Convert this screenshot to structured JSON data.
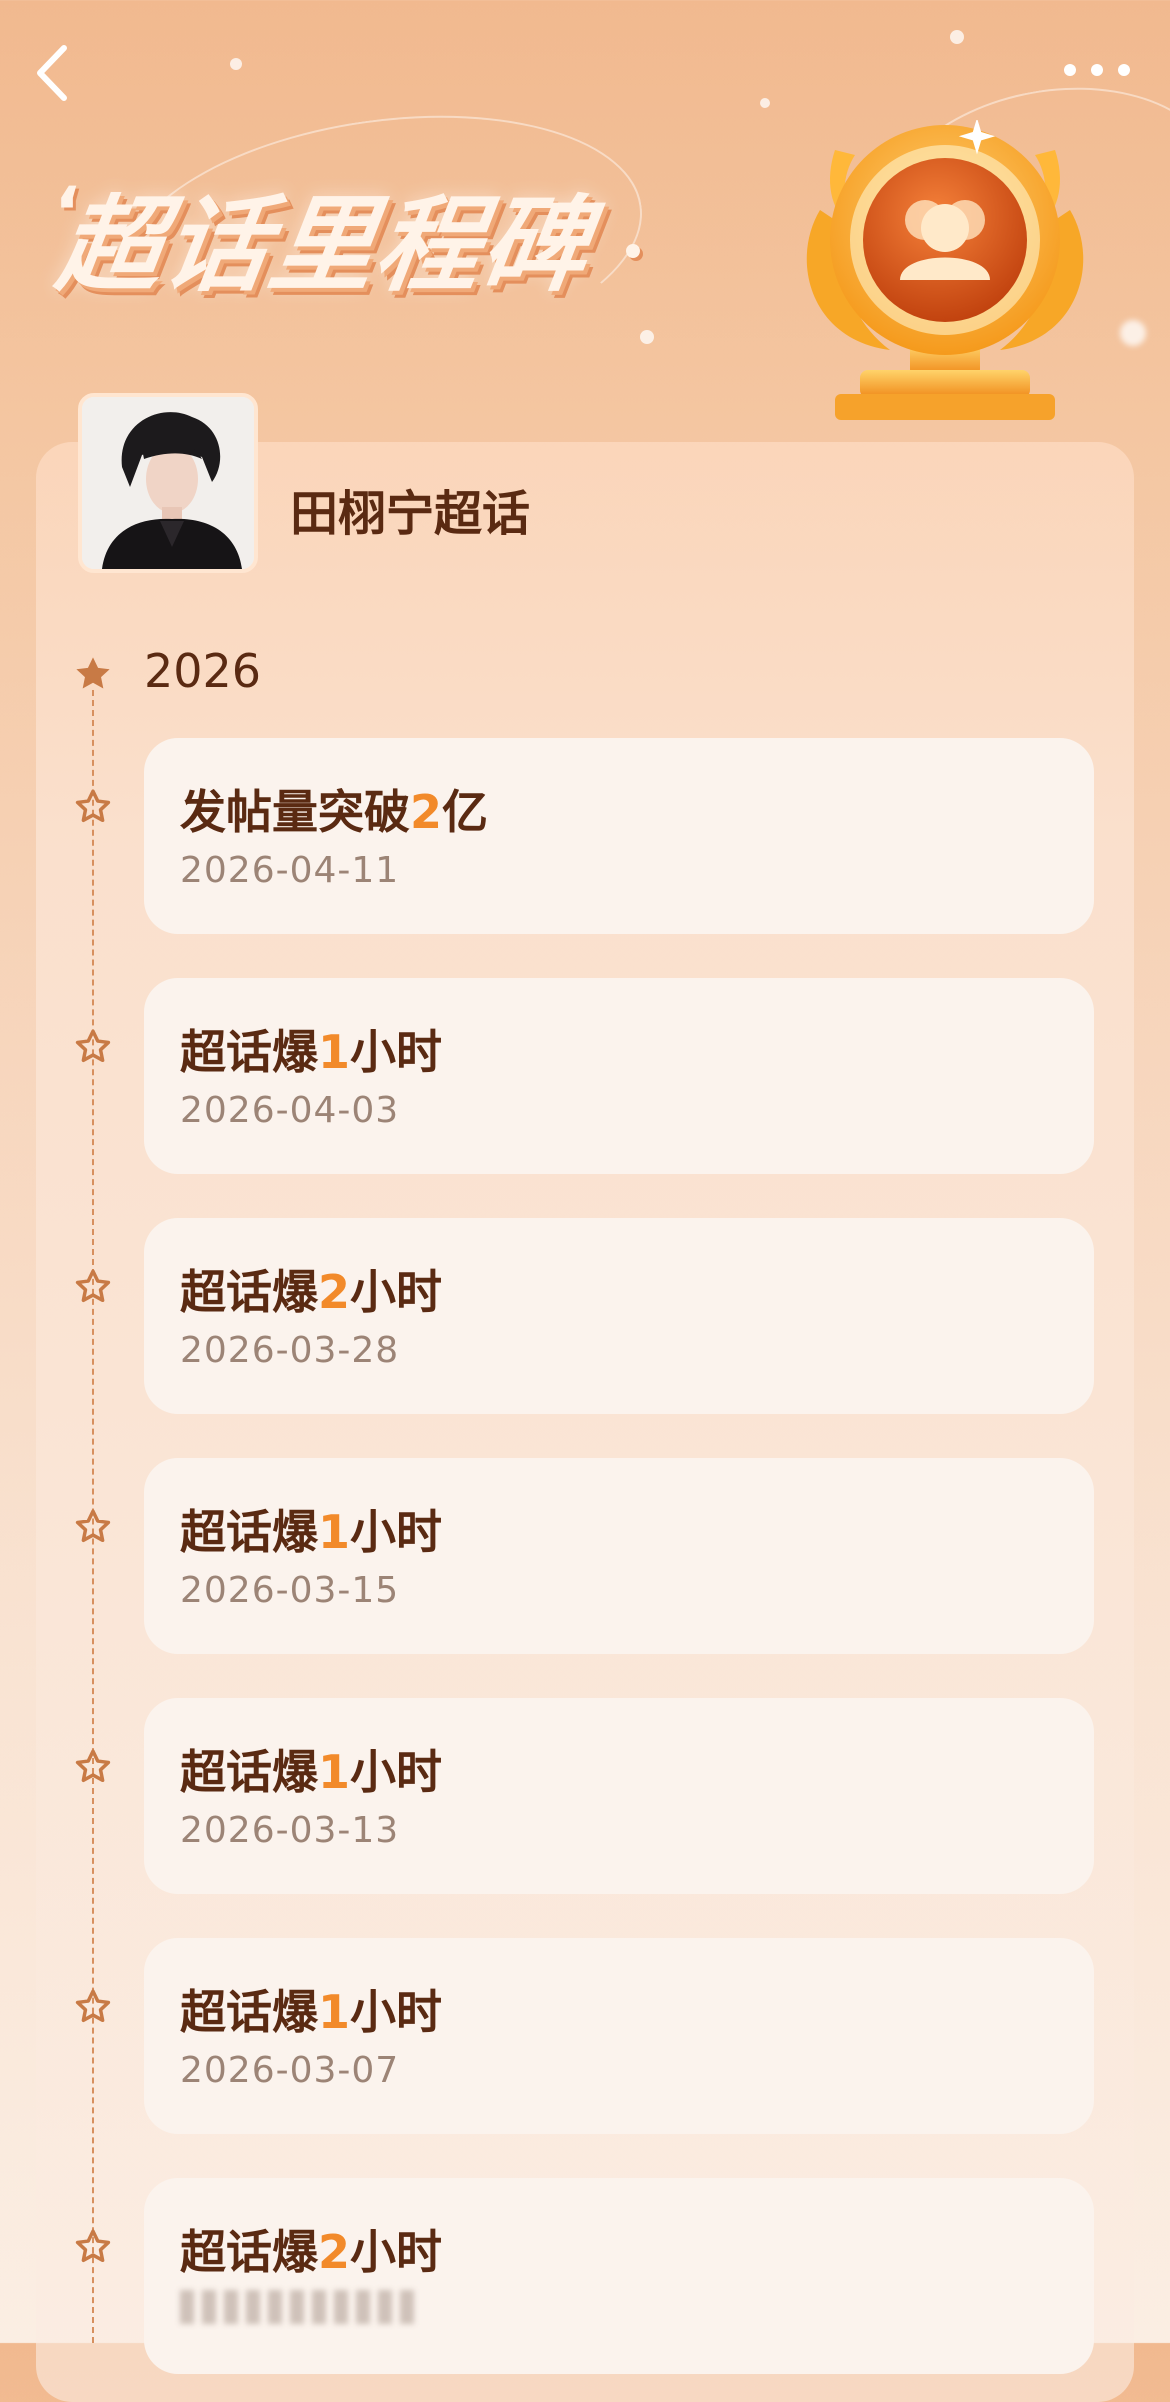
{
  "header": {
    "title": "超话里程碑",
    "back_icon": "chevron-left-icon",
    "more_icon": "more-horizontal-icon"
  },
  "badge": {
    "icon": "group-trophy-icon"
  },
  "topic": {
    "name": "田栩宁超话"
  },
  "timeline": {
    "year": "2026",
    "items": [
      {
        "prefix": "发帖量突破",
        "number": "2",
        "suffix": "亿",
        "date": "2026-04-11"
      },
      {
        "prefix": "超话爆",
        "number": "1",
        "suffix": "小时",
        "date": "2026-04-03"
      },
      {
        "prefix": "超话爆",
        "number": "2",
        "suffix": "小时",
        "date": "2026-03-28"
      },
      {
        "prefix": "超话爆",
        "number": "1",
        "suffix": "小时",
        "date": "2026-03-15"
      },
      {
        "prefix": "超话爆",
        "number": "1",
        "suffix": "小时",
        "date": "2026-03-13"
      },
      {
        "prefix": "超话爆",
        "number": "1",
        "suffix": "小时",
        "date": "2026-03-07"
      },
      {
        "prefix": "超话爆",
        "number": "2",
        "suffix": "小时",
        "date": ""
      }
    ]
  },
  "colors": {
    "accent_number": "#f28a2a",
    "title_text": "#5a2a12",
    "date_text": "#9c8476",
    "timeline": "#d7905f"
  }
}
